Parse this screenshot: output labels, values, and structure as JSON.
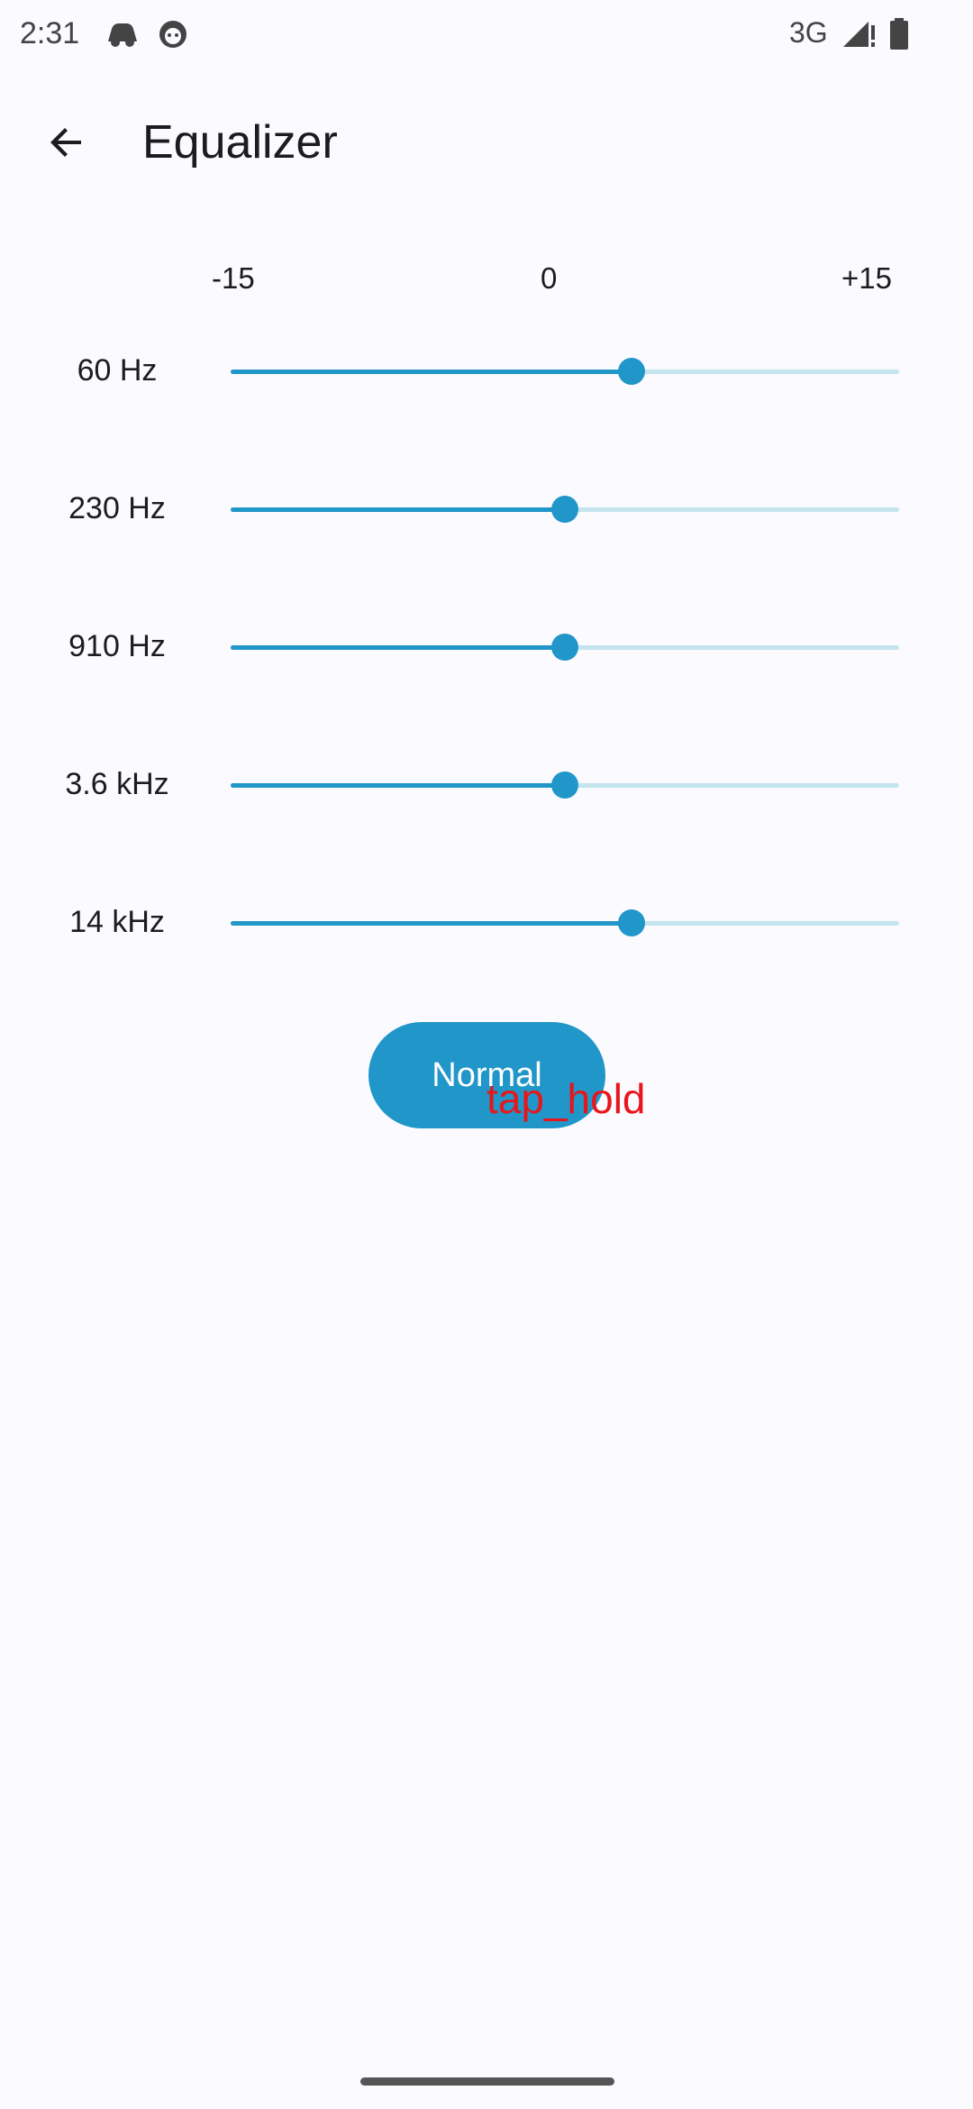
{
  "status_bar": {
    "time": "2:31",
    "network": "3G",
    "icons": [
      "incognito-car-icon",
      "android-bot-icon",
      "signal-icon",
      "battery-icon"
    ]
  },
  "app_bar": {
    "title": "Equalizer",
    "back_icon": "arrow-back-icon"
  },
  "scale": {
    "min_label": "-15",
    "mid_label": "0",
    "max_label": "+15",
    "min": -15,
    "max": 15
  },
  "bands": [
    {
      "label": "60 Hz",
      "value": 3
    },
    {
      "label": "230 Hz",
      "value": 0
    },
    {
      "label": "910 Hz",
      "value": 0
    },
    {
      "label": "3.6 kHz",
      "value": 0
    },
    {
      "label": "14 kHz",
      "value": 3
    }
  ],
  "preset_button": {
    "label": "Normal"
  },
  "annotation": {
    "text": "tap_hold"
  },
  "colors": {
    "accent": "#2196c9",
    "track_inactive": "#c4e4f0",
    "background": "#fbfaff",
    "annotation": "#e8151b"
  }
}
